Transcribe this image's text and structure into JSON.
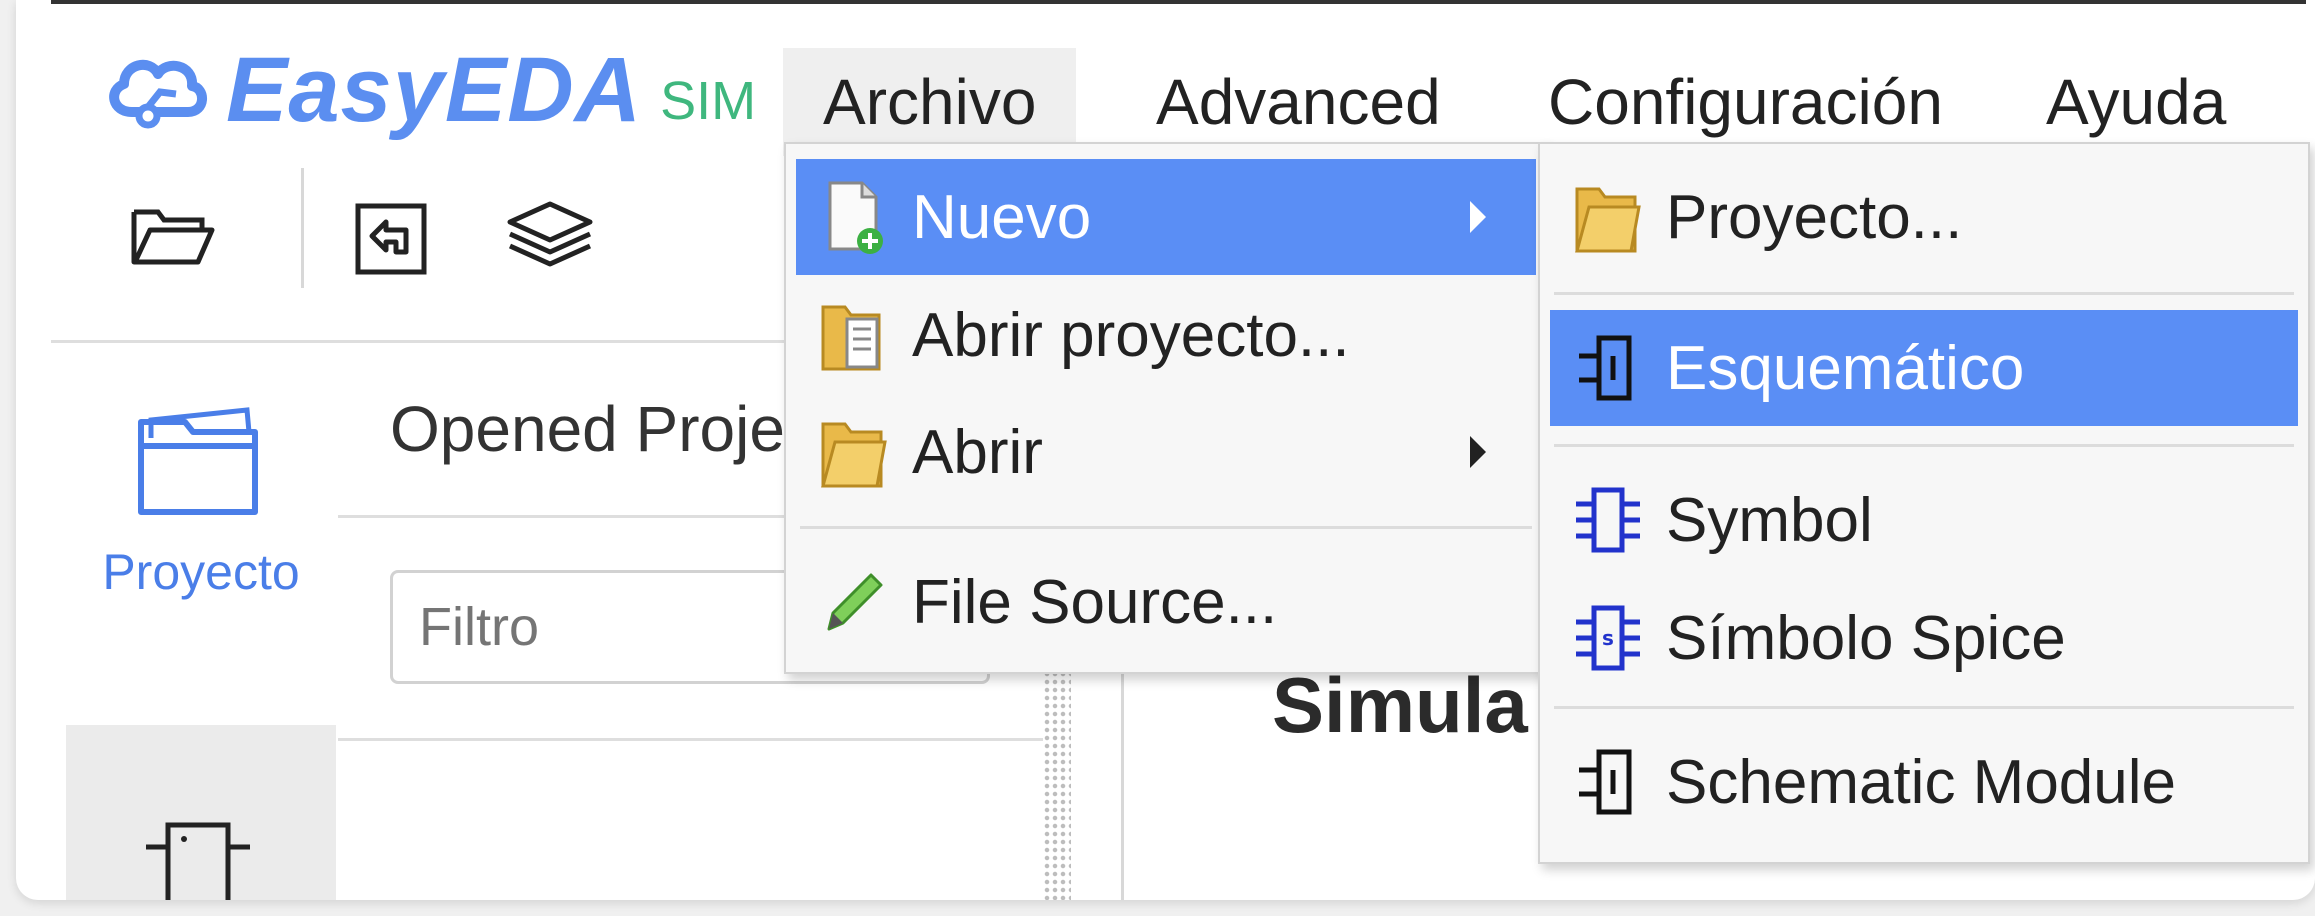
{
  "app": {
    "logo_name": "EasyEDA",
    "logo_sim": "SIM"
  },
  "menubar": {
    "items": [
      {
        "label": "Archivo"
      },
      {
        "label": "Advanced"
      },
      {
        "label": "Configuración"
      },
      {
        "label": "Ayuda"
      }
    ]
  },
  "toolbar": {
    "icons": [
      "folder-open-icon",
      "import-icon",
      "layers-icon"
    ]
  },
  "sidebar": {
    "tab_label": "Proyecto",
    "panel_title": "Opened Proje",
    "filter_placeholder": "Filtro"
  },
  "main": {
    "heading_fragment": "Simula"
  },
  "archivo_menu": {
    "items": [
      {
        "label": "Nuevo",
        "icon": "new-file-icon",
        "submenu": true,
        "highlighted": true
      },
      {
        "label": "Abrir proyecto...",
        "icon": "folder-doc-icon"
      },
      {
        "label": "Abrir",
        "icon": "folder-icon",
        "submenu": true
      },
      {
        "label": "File Source...",
        "icon": "pencil-icon"
      }
    ]
  },
  "nuevo_submenu": {
    "items": [
      {
        "label": "Proyecto...",
        "icon": "folder-icon"
      },
      {
        "label": "Esquemático",
        "icon": "schematic-icon",
        "highlighted": true
      },
      {
        "label": "Symbol",
        "icon": "symbol-icon"
      },
      {
        "label": "Símbolo Spice",
        "icon": "spice-symbol-icon"
      },
      {
        "label": "Schematic Module",
        "icon": "schematic-module-icon"
      }
    ]
  },
  "colors": {
    "brand_blue": "#5b8ef0",
    "sim_green": "#3fb77e",
    "menu_highlight": "#5a8ef5"
  }
}
